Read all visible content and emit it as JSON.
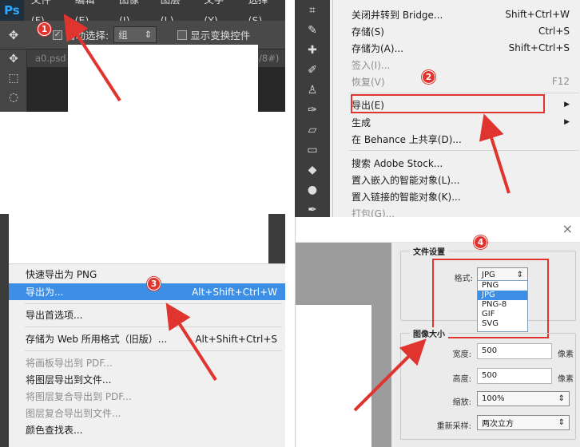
{
  "panel1": {
    "app_logo": "Ps",
    "menus": [
      "文件(F)",
      "编辑(E)",
      "图像(I)",
      "图层(L)",
      "文字(Y)",
      "选择(S)"
    ],
    "options": {
      "auto_select_label": "自动选择:",
      "group_value": "组",
      "show_transform_label": "显示变换控件"
    },
    "doc_tab": "a0.psd @ 100% (谷歌浏览器如何清除浏览数据, RGB/8#)"
  },
  "panel2": {
    "menu_items": [
      {
        "label": "关闭并转到 Bridge...",
        "shortcut": "Shift+Ctrl+W",
        "enabled": true
      },
      {
        "label": "存储(S)",
        "shortcut": "Ctrl+S",
        "enabled": true
      },
      {
        "label": "存储为(A)...",
        "shortcut": "Shift+Ctrl+S",
        "enabled": true
      },
      {
        "label": "签入(I)...",
        "shortcut": "",
        "enabled": false
      },
      {
        "label": "恢复(V)",
        "shortcut": "F12",
        "enabled": false
      },
      {
        "label": "导出(E)",
        "shortcut": "",
        "enabled": true,
        "submenu": true
      },
      {
        "label": "生成",
        "shortcut": "",
        "enabled": true,
        "submenu": true
      },
      {
        "label": "在 Behance 上共享(D)...",
        "shortcut": "",
        "enabled": true
      },
      {
        "label": "搜索 Adobe Stock...",
        "shortcut": "",
        "enabled": true
      },
      {
        "label": "置入嵌入的智能对象(L)...",
        "shortcut": "",
        "enabled": true
      },
      {
        "label": "置入链接的智能对象(K)...",
        "shortcut": "",
        "enabled": true
      },
      {
        "label": "打包(G)...",
        "shortcut": "",
        "enabled": false
      }
    ]
  },
  "panel3": {
    "menu_items": [
      {
        "label": "快速导出为 PNG",
        "shortcut": "",
        "enabled": true
      },
      {
        "label": "导出为...",
        "shortcut": "Alt+Shift+Ctrl+W",
        "enabled": true,
        "selected": true
      },
      {
        "label": "导出首选项...",
        "shortcut": "",
        "enabled": true
      },
      {
        "label": "存储为 Web 所用格式（旧版）...",
        "shortcut": "Alt+Shift+Ctrl+S",
        "enabled": true
      },
      {
        "label": "将画板导出到 PDF...",
        "shortcut": "",
        "enabled": false
      },
      {
        "label": "将图层导出到文件...",
        "shortcut": "",
        "enabled": true
      },
      {
        "label": "将图层复合导出到 PDF...",
        "shortcut": "",
        "enabled": false
      },
      {
        "label": "图层复合导出到文件...",
        "shortcut": "",
        "enabled": false
      },
      {
        "label": "颜色查找表...",
        "shortcut": "",
        "enabled": true
      }
    ]
  },
  "panel4": {
    "close_glyph": "×",
    "file_settings": {
      "legend": "文件设置",
      "format_label": "格式:",
      "format_value": "JPG",
      "format_options": [
        "PNG",
        "JPG",
        "PNG-8",
        "GIF",
        "SVG"
      ],
      "selected_option": "JPG"
    },
    "image_size": {
      "legend": "图像大小",
      "width_label": "宽度:",
      "width_value": "500",
      "height_label": "高度:",
      "height_value": "500",
      "unit": "像素",
      "scale_label": "缩放:",
      "scale_value": "100%",
      "resample_label": "重新采样:",
      "resample_value": "两次立方"
    }
  },
  "annotations": {
    "steps": [
      "1",
      "2",
      "3",
      "4"
    ],
    "accent": "#e0342f"
  }
}
